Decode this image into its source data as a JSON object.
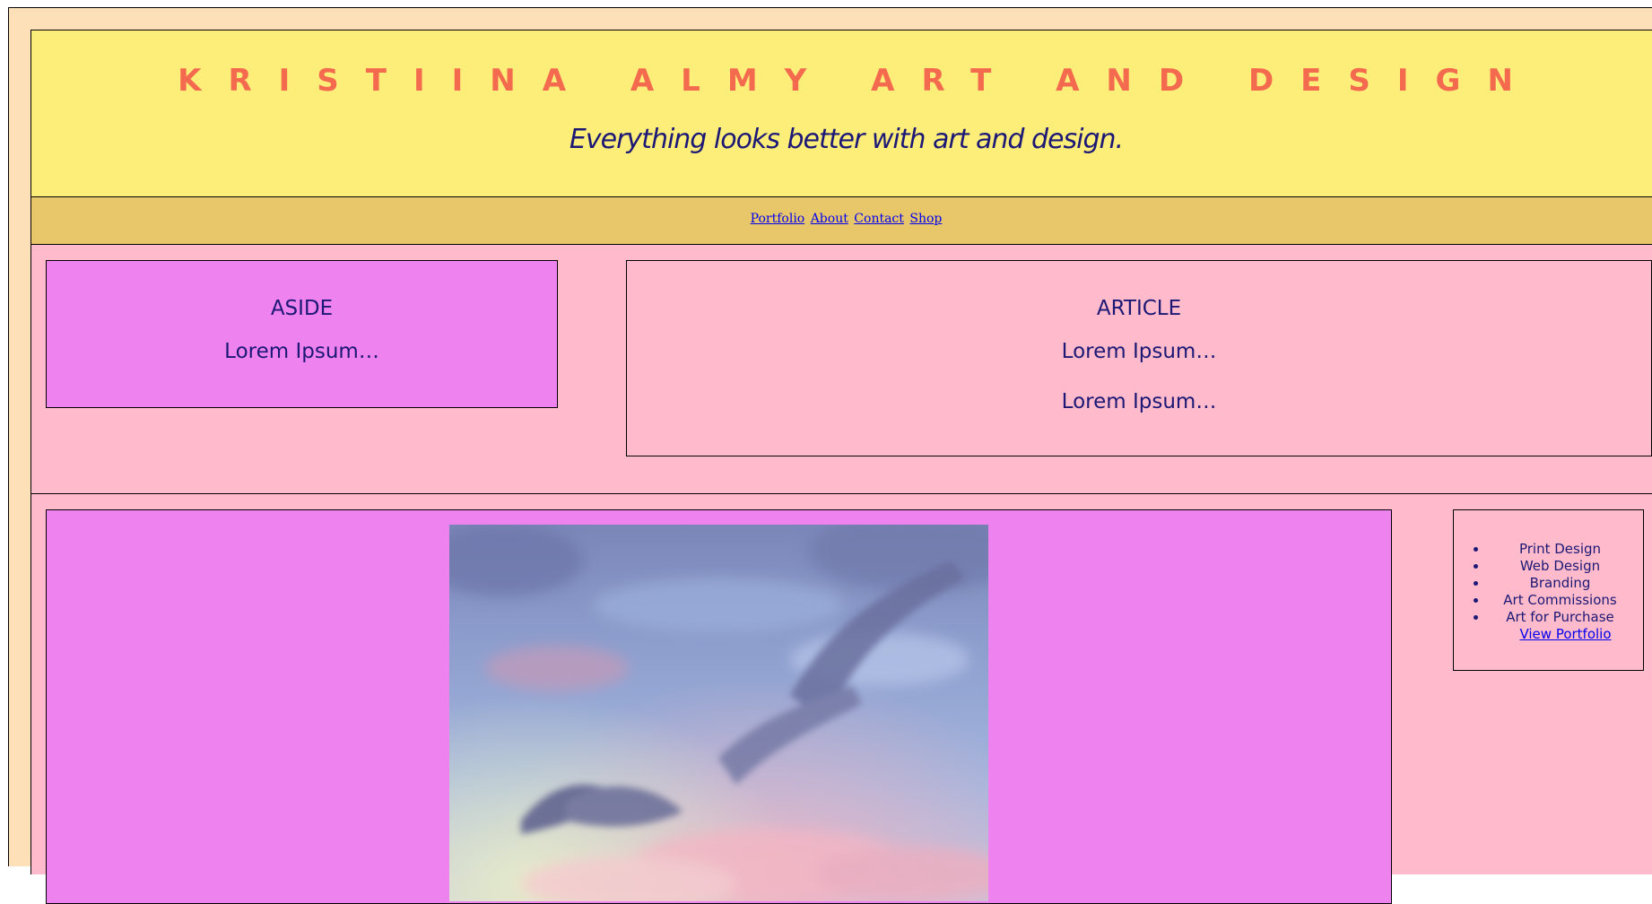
{
  "header": {
    "title": "KRISTIINA ALMY ART AND DESIGN",
    "tagline": "Everything looks better with art and design."
  },
  "nav": {
    "items": [
      {
        "label": "Portfolio"
      },
      {
        "label": "About"
      },
      {
        "label": "Contact"
      },
      {
        "label": "Shop"
      }
    ]
  },
  "aside": {
    "heading": "ASIDE",
    "text": "Lorem Ipsum…"
  },
  "article": {
    "heading": "ARTICLE",
    "paragraphs": [
      "Lorem Ipsum…",
      "Lorem Ipsum…"
    ]
  },
  "services": {
    "items": [
      "Print Design",
      "Web Design",
      "Branding",
      "Art Commissions",
      "Art for Purchase"
    ],
    "link_label": "View Portfolio"
  },
  "colors": {
    "page_bg": "#fde0b8",
    "header_bg": "#fdee7a",
    "nav_bg": "#e8c66a",
    "content_bg": "#ffbacb",
    "aside_bg": "#ee82ee",
    "title_color": "#f46a4e",
    "text_color": "#1c1875",
    "link_color": "#0000ee"
  }
}
